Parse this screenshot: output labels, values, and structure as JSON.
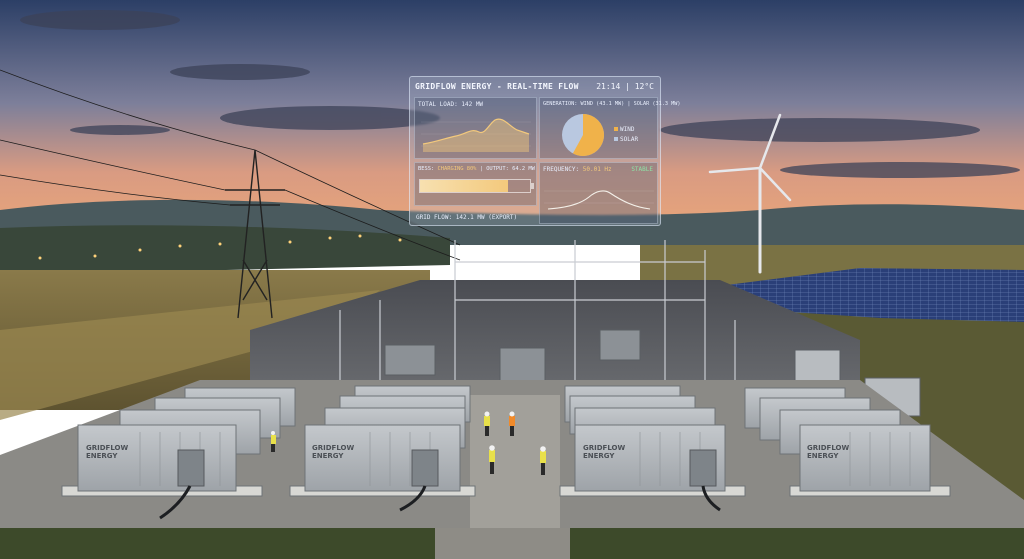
{
  "hud": {
    "title": "GRIDFLOW ENERGY - REAL-TIME FLOW",
    "time": "21:14",
    "temp": "12°C",
    "load": {
      "label": "TOTAL LOAD:",
      "value": "142 MW"
    },
    "generation": {
      "label": "GENERATION:",
      "wind": "WIND (43.1 MW)",
      "solar": "SOLAR (31.3 MW)",
      "legend": [
        "WIND",
        "SOLAR"
      ],
      "wind_share": 0.58
    },
    "bess": {
      "label": "BESS:",
      "status": "CHARGING 80%",
      "output": "OUTPUT: 64.2 MW",
      "charge_fraction": 0.8
    },
    "frequency": {
      "label": "FREQUENCY:",
      "value": "50.01 Hz",
      "status": "STABLE"
    },
    "grid_flow": "GRID FLOW: 142.1 MW (EXPORT)"
  },
  "containers": {
    "brand_line1": "GRIDFLOW",
    "brand_line2": "ENERGY"
  },
  "colors": {
    "accent_orange": "#f3c97c",
    "wind_slice": "#f0b24a",
    "solar_slice": "#b9c8e0",
    "stable_green": "#8ee3a6"
  }
}
